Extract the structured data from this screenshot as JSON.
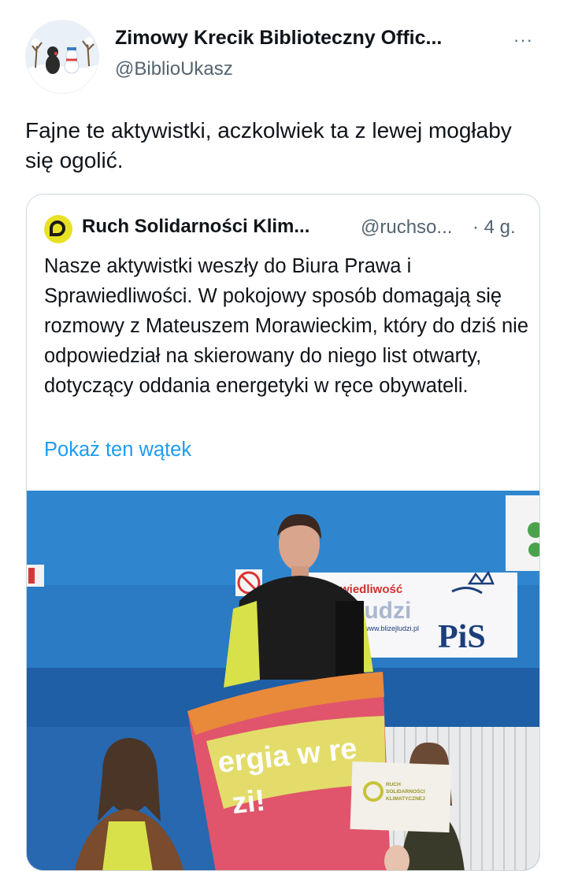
{
  "tweet": {
    "author_name": "Zimowy Krecik Biblioteczny Offic...",
    "author_handle": "@BiblioUkasz",
    "more_icon": "···",
    "text": "Fajne te aktywistki, aczkolwiek ta z lewej mogłaby się ogolić."
  },
  "quote": {
    "author_name": "Ruch Solidarności Klim...",
    "author_handle": "@ruchso...",
    "time": "· 4 g.",
    "text": "Nasze aktywistki weszły do Biura Prawa i Sprawiedliwości. W pokojowy sposób domagają się rozmowy z Mateuszem Morawieckim, który do dziś nie odpowiedział na skierowany do niego list otwarty, dotyczący oddania energetyki w ręce obywateli.",
    "show_thread": "Pokaż ten wątek"
  },
  "photo": {
    "banner_line1": "wiedliwość",
    "banner_line2": "ludzi",
    "banner_url": "www.blizejludzi.pl",
    "banner_logo": "PiS",
    "flag_text_1": "ergia w re",
    "flag_text_2": "zi!",
    "sign_text_1": "RUCH",
    "sign_text_2": "SOLIDARNOŚCI",
    "sign_text_3": "KLIMATYCZNEJ"
  },
  "colors": {
    "link": "#1d9bf0",
    "secondary_text": "#536471",
    "quote_avatar": "#e8e125",
    "wall_blue": "#2a7bc4"
  }
}
